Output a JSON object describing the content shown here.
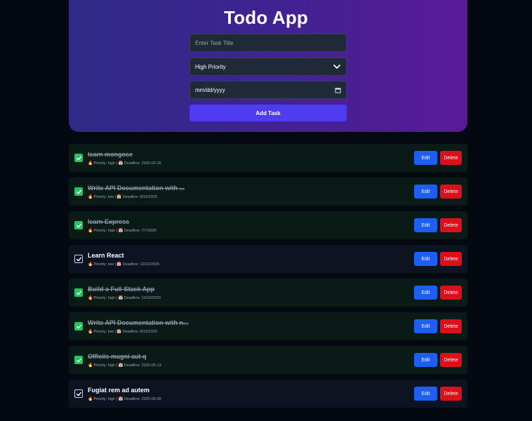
{
  "app": {
    "title": "Todo App"
  },
  "form": {
    "title_placeholder": "Enter Task Title",
    "priority_selected": "High Priority",
    "deadline_placeholder": "mm/dd/yyyy",
    "add_button": "Add Task"
  },
  "labels": {
    "edit": "Edit",
    "delete": "Delete"
  },
  "colors": {
    "accent": "#4f3bf0",
    "done_check": "#22c55e",
    "edit": "#1d5ff2",
    "delete": "#dc0f1a"
  },
  "tasks": [
    {
      "title": "learn mongose",
      "done": true,
      "meta": "Priority: high | 📅 Deadline: 2025-02-26"
    },
    {
      "title": "Write API Documentation with ...",
      "done": true,
      "meta": "Priority: low | 📅 Deadline: 8/15/2025"
    },
    {
      "title": "learn Express",
      "done": true,
      "meta": "Priority: high | 📅 Deadline: 7/7/2025"
    },
    {
      "title": "Learn React",
      "done": false,
      "meta": "Priority: low | 📅 Deadline: 12/12/2025"
    },
    {
      "title": "Build a Full-Stack App",
      "done": true,
      "meta": "Priority: high | 📅 Deadline: 10/10/2025"
    },
    {
      "title": "Write API Documentation with n...",
      "done": true,
      "meta": "Priority: low | 📅 Deadline: 8/15/2025"
    },
    {
      "title": "Officiis magni aut q",
      "done": true,
      "meta": "Priority: high | 📅 Deadline: 2025-05-13"
    },
    {
      "title": "Fugiat rem ad autem",
      "done": false,
      "meta": "Priority: high | 📅 Deadline: 2025-05-09"
    }
  ]
}
